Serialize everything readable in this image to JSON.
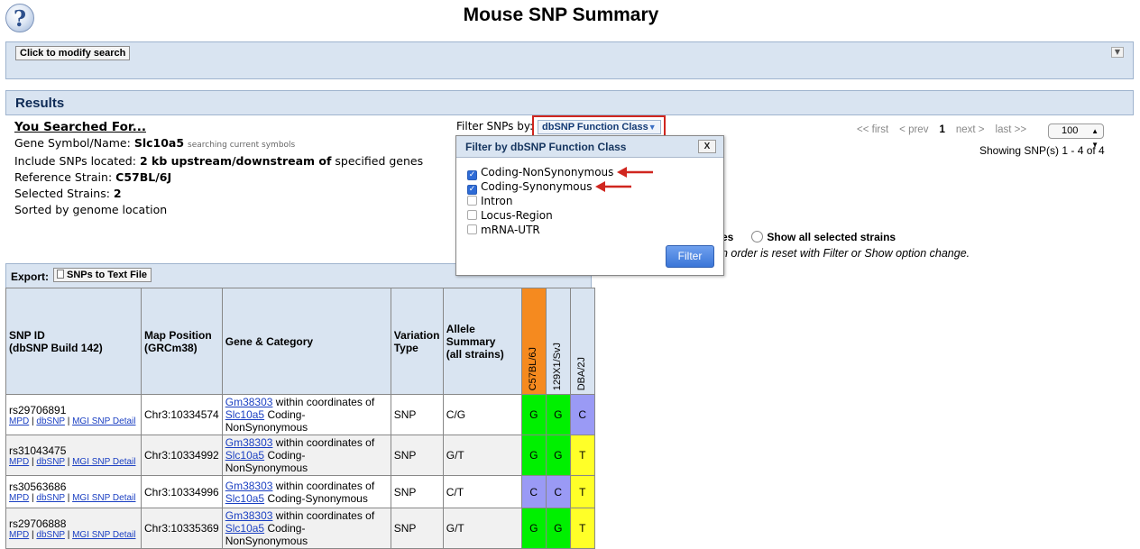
{
  "page": {
    "title": "Mouse SNP Summary",
    "help_icon": "?"
  },
  "search_bar": {
    "modify_label": "Click to modify search",
    "toggle_icon": "chevron-down-icon"
  },
  "results": {
    "heading": "Results"
  },
  "searched_for": {
    "heading": "You Searched For...",
    "gene_label": "Gene Symbol/Name:",
    "gene_value": "Slc10a5",
    "gene_note": "searching current symbols",
    "include_label": "Include SNPs located:",
    "include_value": "2 kb upstream/downstream of",
    "include_suffix": "specified genes",
    "ref_label": "Reference Strain:",
    "ref_value": "C57BL/6J",
    "strains_label": "Selected Strains:",
    "strains_value": "2",
    "sorted": "Sorted by genome location"
  },
  "filter": {
    "label": "Filter SNPs by:",
    "button_label": "dbSNP Function Class",
    "popup": {
      "title": "Filter by dbSNP Function Class",
      "close_label": "X",
      "options": [
        {
          "label": "Coding-NonSynonymous",
          "checked": true
        },
        {
          "label": "Coding-Synonymous",
          "checked": true
        },
        {
          "label": "Intron",
          "checked": false
        },
        {
          "label": "Locus-Region",
          "checked": false
        },
        {
          "label": "mRNA-UTR",
          "checked": false
        }
      ],
      "submit_label": "Filter"
    }
  },
  "pager": {
    "first": "<< first",
    "prev": "< prev",
    "current": "1",
    "next": "next >",
    "last": "last >>",
    "per_page": "100",
    "showing": "Showing SNP(s) 1 - 4 of 4"
  },
  "show_options": {
    "partial_label": "es",
    "all_label": "Show all selected strains",
    "note": "n order is reset with Filter or Show option change."
  },
  "export": {
    "label": "Export:",
    "button_label": "SNPs to Text File"
  },
  "table": {
    "headers": {
      "snp_id": "SNP ID",
      "snp_id_sub": "(dbSNP Build 142)",
      "map": "Map Position",
      "map_sub": "(GRCm38)",
      "gene": "Gene & Category",
      "variation": "Variation",
      "variation_sub": "Type",
      "allele": "Allele",
      "allele_sub": "Summary",
      "allele_sub2": "(all strains)",
      "strains": [
        "C57BL/6J",
        "129X1/SvJ",
        "DBA/2J"
      ]
    },
    "strain_header_colors": [
      "#f58a1f",
      "#d9e4f1",
      "#d9e4f1"
    ],
    "link_labels": {
      "mpd": "MPD",
      "dbsnp": "dbSNP",
      "mgi": "MGI SNP Detail"
    },
    "rows": [
      {
        "id": "rs29706891",
        "map": "Chr3:10334574",
        "gene_link": "Gm38303",
        "gene_text": "within coordinates of",
        "gene_link2": "Slc10a5",
        "category": "Coding-NonSynonymous",
        "type": "SNP",
        "allele": "C/G",
        "alleles": [
          "G",
          "G",
          "C"
        ],
        "colors": [
          "#00f000",
          "#00f000",
          "#9a9af5"
        ]
      },
      {
        "id": "rs31043475",
        "map": "Chr3:10334992",
        "gene_link": "Gm38303",
        "gene_text": "within coordinates of",
        "gene_link2": "Slc10a5",
        "category": "Coding-NonSynonymous",
        "type": "SNP",
        "allele": "G/T",
        "alleles": [
          "G",
          "G",
          "T"
        ],
        "colors": [
          "#00f000",
          "#00f000",
          "#ffff28"
        ]
      },
      {
        "id": "rs30563686",
        "map": "Chr3:10334996",
        "gene_link": "Gm38303",
        "gene_text": "within coordinates of",
        "gene_link2": "Slc10a5",
        "category": "Coding-Synonymous",
        "type": "SNP",
        "allele": "C/T",
        "alleles": [
          "C",
          "C",
          "T"
        ],
        "colors": [
          "#9a9af5",
          "#9a9af5",
          "#ffff28"
        ]
      },
      {
        "id": "rs29706888",
        "map": "Chr3:10335369",
        "gene_link": "Gm38303",
        "gene_text": "within coordinates of",
        "gene_link2": "Slc10a5",
        "category": "Coding-NonSynonymous",
        "type": "SNP",
        "allele": "G/T",
        "alleles": [
          "G",
          "G",
          "T"
        ],
        "colors": [
          "#00f000",
          "#00f000",
          "#ffff28"
        ]
      }
    ]
  },
  "annotation_color": "#d0261f"
}
